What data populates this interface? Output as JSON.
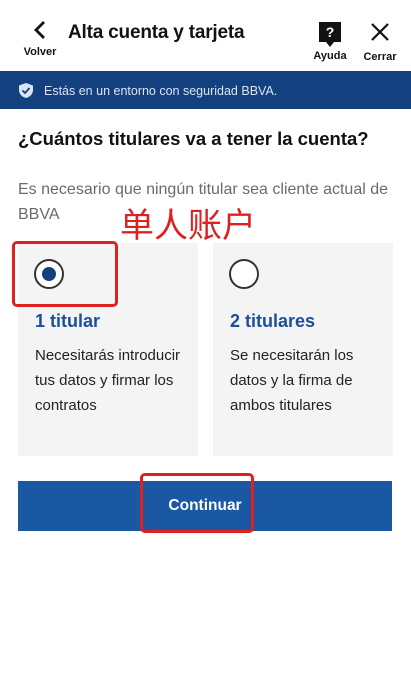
{
  "header": {
    "back_label": "Volver",
    "title": "Alta cuenta y tarjeta",
    "help_label": "Ayuda",
    "close_label": "Cerrar"
  },
  "banner": {
    "text": "Estás en un entorno con seguridad BBVA."
  },
  "question": "¿Cuántos titulares va a tener la cuenta?",
  "subtitle": "Es necesario que ningún titular sea cliente actual de BBVA",
  "annotation": "单人账户",
  "options": [
    {
      "title": "1 titular",
      "description": "Necesitarás introducir tus datos y firmar los contratos",
      "selected": true
    },
    {
      "title": "2 titulares",
      "description": "Se necesitarán los datos y la firma de ambos titulares",
      "selected": false
    }
  ],
  "continue_label": "Continuar",
  "colors": {
    "brand": "#134180",
    "button": "#1a58a3",
    "link": "#1b4f9a",
    "annotation": "#e02020"
  }
}
